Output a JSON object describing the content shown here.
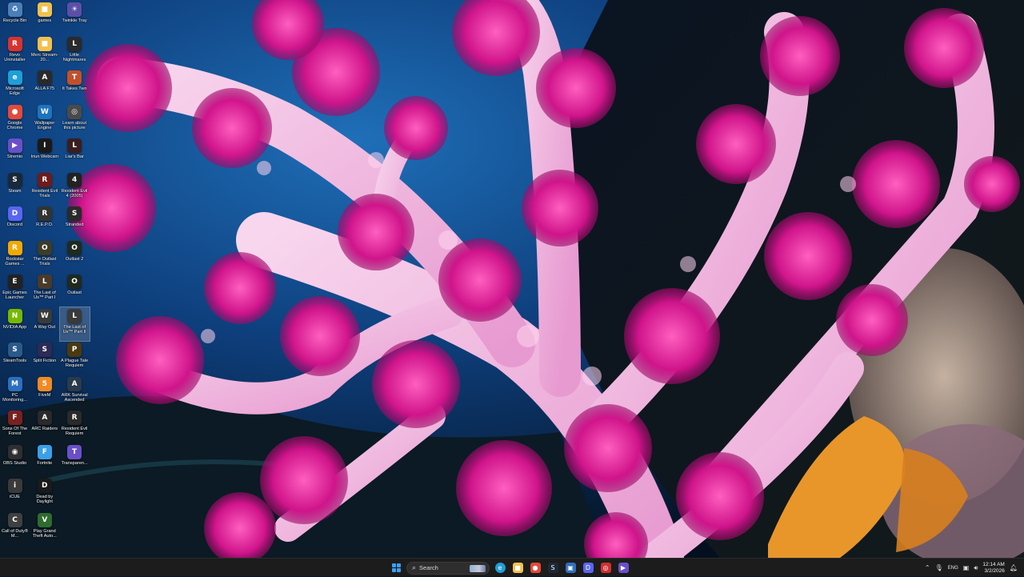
{
  "desktop": {
    "icons": [
      {
        "label": "Recycle Bin",
        "glyph": "♻",
        "color": "#4a7fb8"
      },
      {
        "label": "Revo Uninstaller",
        "glyph": "R",
        "color": "#d8322e"
      },
      {
        "label": "Microsoft Edge",
        "glyph": "e",
        "color": "#1f9fd6"
      },
      {
        "label": "Google Chrome",
        "glyph": "●",
        "color": "#e24a3b"
      },
      {
        "label": "Stremio",
        "glyph": "▶",
        "color": "#6a4fc9"
      },
      {
        "label": "Steam",
        "glyph": "S",
        "color": "#1b2838"
      },
      {
        "label": "Discord",
        "glyph": "D",
        "color": "#5865f2"
      },
      {
        "label": "Rockstar Games ...",
        "glyph": "R",
        "color": "#f2a900"
      },
      {
        "label": "Epic Games Launcher",
        "glyph": "E",
        "color": "#222222"
      },
      {
        "label": "NVIDIA App",
        "glyph": "N",
        "color": "#76b900"
      },
      {
        "label": "SteamTools",
        "glyph": "S",
        "color": "#2a5a8a"
      },
      {
        "label": "PC Monitoring...",
        "glyph": "M",
        "color": "#2c6fbf"
      },
      {
        "label": "Sons Of The Forest",
        "glyph": "F",
        "color": "#7a2020"
      },
      {
        "label": "OBS Studio",
        "glyph": "◉",
        "color": "#302e31"
      },
      {
        "label": "iCUE",
        "glyph": "i",
        "color": "#3a3a3a"
      },
      {
        "label": "Call of Duty® M...",
        "glyph": "C",
        "color": "#404040"
      },
      {
        "label": "games",
        "glyph": "■",
        "color": "#f2c14e"
      },
      {
        "label": "Merc Stream-20...",
        "glyph": "■",
        "color": "#f2c14e"
      },
      {
        "label": "ALLA F75",
        "glyph": "A",
        "color": "#2a2a2a"
      },
      {
        "label": "Wallpaper Engine",
        "glyph": "W",
        "color": "#1e73be"
      },
      {
        "label": "Iriun Webcam",
        "glyph": "I",
        "color": "#1a1a1a"
      },
      {
        "label": "Resident Evil Trials",
        "glyph": "R",
        "color": "#6e1b1b"
      },
      {
        "label": "R.E.P.O.",
        "glyph": "R",
        "color": "#333333"
      },
      {
        "label": "The Outlast Trials",
        "glyph": "O",
        "color": "#3c3c28"
      },
      {
        "label": "The Last of Us™ Part I",
        "glyph": "L",
        "color": "#4a3a2a"
      },
      {
        "label": "A Way Out",
        "glyph": "W",
        "color": "#3a3a3a"
      },
      {
        "label": "Split Fiction",
        "glyph": "S",
        "color": "#2b2b55"
      },
      {
        "label": "FiveM",
        "glyph": "5",
        "color": "#f08a24"
      },
      {
        "label": "ARC Raiders",
        "glyph": "A",
        "color": "#2a2a2a"
      },
      {
        "label": "Fortnite",
        "glyph": "F",
        "color": "#3aa0e8"
      },
      {
        "label": "Dead by Daylight",
        "glyph": "D",
        "color": "#1a1a1a"
      },
      {
        "label": "Play Grand Theft Auto...",
        "glyph": "V",
        "color": "#2f6b2f"
      },
      {
        "label": "Twinkle Tray",
        "glyph": "☀",
        "color": "#5b4fa8"
      },
      {
        "label": "Little Nightmares",
        "glyph": "L",
        "color": "#2a2a2a"
      },
      {
        "label": "It Takes Two",
        "glyph": "T",
        "color": "#c4502a"
      },
      {
        "label": "Learn about this picture",
        "glyph": "◎",
        "color": "#4a4a4a"
      },
      {
        "label": "Liar's Bar",
        "glyph": "L",
        "color": "#3a1e1e"
      },
      {
        "label": "Resident Evil 4 (2005)",
        "glyph": "4",
        "color": "#222222"
      },
      {
        "label": "Stranded",
        "glyph": "S",
        "color": "#2a2a2a"
      },
      {
        "label": "Outlast 2",
        "glyph": "O",
        "color": "#1f2a1f"
      },
      {
        "label": "Outlast",
        "glyph": "O",
        "color": "#1f2a1f"
      },
      {
        "label": "The Last of Us™ Part II",
        "glyph": "L",
        "color": "#3a3a3a"
      },
      {
        "label": "A Plague Tale Requiem",
        "glyph": "P",
        "color": "#4a3a10"
      },
      {
        "label": "ARK Survival Ascended",
        "glyph": "A",
        "color": "#2a3a4a"
      },
      {
        "label": "Resident Evil Requiem",
        "glyph": "R",
        "color": "#2a2a2a"
      },
      {
        "label": "Transparen...",
        "glyph": "T",
        "color": "#6a4fc9"
      }
    ]
  },
  "taskbar": {
    "search_placeholder": "Search",
    "pinned": [
      {
        "name": "taskbar-file-explorer",
        "glyph": "■",
        "color": "#f2c14e"
      },
      {
        "name": "taskbar-chrome",
        "glyph": "●",
        "color": "#e24a3b"
      },
      {
        "name": "taskbar-steam",
        "glyph": "S",
        "color": "#1b2838"
      },
      {
        "name": "taskbar-app-blue",
        "glyph": "▣",
        "color": "#2f6fbf"
      },
      {
        "name": "taskbar-discord",
        "glyph": "D",
        "color": "#5865f2"
      },
      {
        "name": "taskbar-app-red",
        "glyph": "◎",
        "color": "#d03030"
      },
      {
        "name": "taskbar-stremio",
        "glyph": "▶",
        "color": "#6a4fc9"
      }
    ],
    "tray": {
      "language": "ENG",
      "time": "12:14 AM",
      "date": "3/2/2026"
    }
  },
  "colors": {
    "taskbar_bg": "#1c1c1c",
    "accent": "#3aa0ff"
  }
}
